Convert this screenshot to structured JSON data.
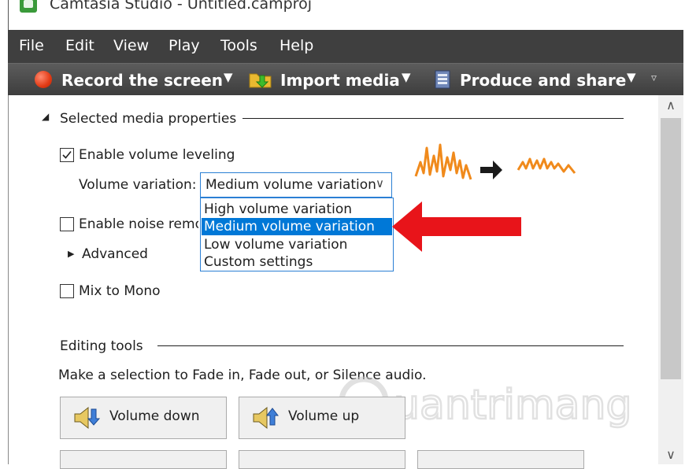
{
  "window": {
    "title": "Camtasia Studio - Untitled.camproj"
  },
  "menu": [
    "File",
    "Edit",
    "View",
    "Play",
    "Tools",
    "Help"
  ],
  "toolbar": {
    "record": "Record the screen",
    "import": "Import media",
    "produce": "Produce and share"
  },
  "section_media": {
    "title": "Selected media properties"
  },
  "volume_leveling": {
    "label": "Enable volume leveling",
    "checked": true,
    "variation_label": "Volume variation:",
    "selected": "Medium volume variation",
    "options": [
      "High volume variation",
      "Medium volume variation",
      "Low volume variation",
      "Custom settings"
    ]
  },
  "noise_removal": {
    "label": "Enable noise removal",
    "checked": false
  },
  "advanced": {
    "label": "Advanced"
  },
  "mono": {
    "label": "Mix to Mono",
    "checked": false
  },
  "editing": {
    "title": "Editing tools",
    "hint": "Make a selection to Fade in, Fade out, or Silence audio.",
    "buttons": [
      "Volume down",
      "Volume up"
    ]
  },
  "watermark": "uantrimang",
  "colors": {
    "menubar": "#3f3f3f",
    "selection": "#0078d7",
    "arrow": "#e8141a",
    "wave": "#f08a1c"
  },
  "icons": [
    "record-icon",
    "import-media-icon",
    "produce-share-icon",
    "volume-down-icon",
    "volume-up-icon"
  ]
}
